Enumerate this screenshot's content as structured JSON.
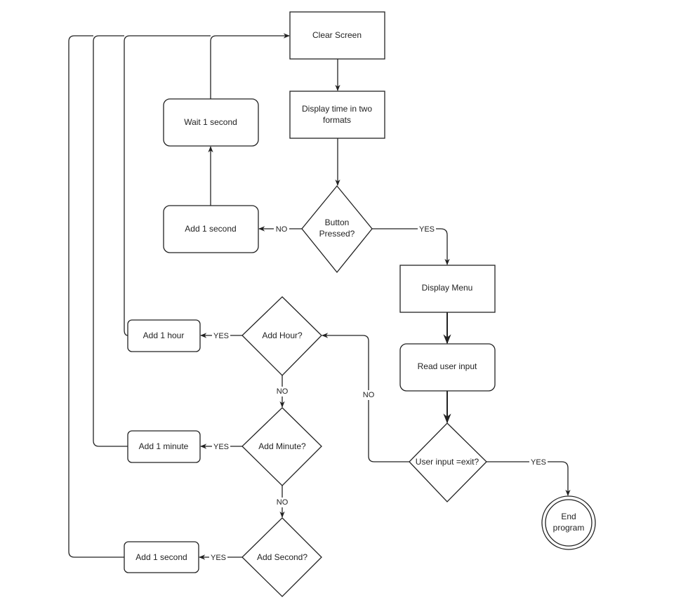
{
  "nodes": {
    "clear_screen": "Clear Screen",
    "display_time": [
      "Display time in two",
      "formats"
    ],
    "button_pressed": [
      "Button",
      "Pressed?"
    ],
    "wait_1_second": "Wait 1 second",
    "add_1_second_top": "Add 1 second",
    "display_menu": "Display Menu",
    "read_user_input": "Read user input",
    "user_input_exit": "User input =exit?",
    "end_program": [
      "End",
      "program"
    ],
    "add_hour": "Add Hour?",
    "add_1_hour": "Add 1 hour",
    "add_minute": "Add Minute?",
    "add_1_minute": "Add 1 minute",
    "add_second": "Add Second?",
    "add_1_second_bottom": "Add 1 second"
  },
  "edge_labels": {
    "button_no": "NO",
    "button_yes": "YES",
    "exit_no": "NO",
    "exit_yes": "YES",
    "hour_yes": "YES",
    "hour_no": "NO",
    "minute_yes": "YES",
    "minute_no": "NO",
    "second_yes": "YES"
  }
}
